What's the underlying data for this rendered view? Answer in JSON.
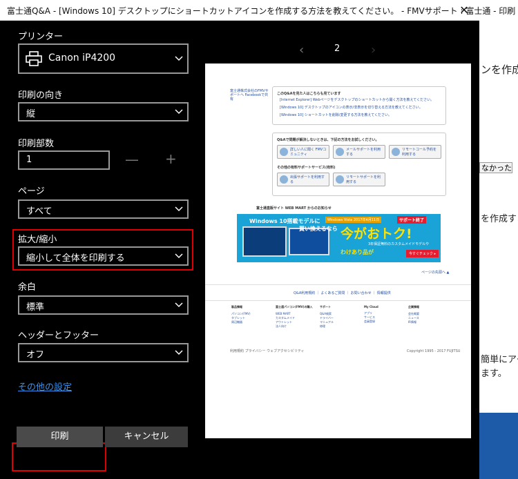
{
  "window": {
    "title": "富士通Q&A - [Windows 10] デスクトップにショートカットアイコンを作成する方法を教えてください。 - FMVサポート : 富士通 - 印刷",
    "close_glyph": "✕"
  },
  "background_page": {
    "text1": "ンを作成",
    "button": "なかった",
    "text2": "を作成す",
    "text3": "簡単にアク",
    "text4": "ます。"
  },
  "settings": {
    "printer_label": "プリンター",
    "printer_value": "Canon iP4200",
    "orientation_label": "印刷の向き",
    "orientation_value": "縦",
    "copies_label": "印刷部数",
    "copies_value": "1",
    "copies_minus": "—",
    "copies_plus": "+",
    "pages_label": "ページ",
    "pages_value": "すべて",
    "scale_label": "拡大/縮小",
    "scale_value": "縮小して全体を印刷する",
    "margins_label": "余白",
    "margins_value": "標準",
    "headers_label": "ヘッダーとフッター",
    "headers_value": "オフ",
    "more_settings": "その他の設定"
  },
  "buttons": {
    "print": "印刷",
    "cancel": "キャンセル"
  },
  "preview": {
    "prev_glyph": "‹",
    "next_glyph": "›",
    "page_number": "2",
    "links_text": "富士通株式会社のFMVサポートへ Facebookで共有",
    "box1_heading": "このQ&Aを見た人はこちらも見ています",
    "box1_items": [
      "[Internet Explorer] Webページをデスクトップのショートカットから開く方法を教えてください。",
      "[Windows 10] デスクトップのアイコンの表示/非表示を切り替える方法を教えてください。",
      "[Windows 10] ショートカットを削除/変更する方法を教えてください。"
    ],
    "box2_heading": "Q&Aで問題が解決しないときは、下記の方法をお試しください。",
    "box2_buttons": [
      "詳しい人に聞く FMVコミュニティ",
      "メールサポートを利用する",
      "リモートコール予約を利用する"
    ],
    "box2_sub": "その他の有料サポートサービス(有料)",
    "box2_buttons2": [
      "出張サポートを利用する",
      "リモートサポートを利用する"
    ],
    "banner_caption": "富士通直販サイト WEB MART からのお知らせ",
    "banner": {
      "t1": "Windows 10搭載モデルに",
      "t1b": "買い換えるなら",
      "t2": "Windows Vista 2017年4月11日",
      "t3": "サポート終了",
      "t4": "今がおトク!",
      "t5": "3年保証無料のカスタムメイドモデルや",
      "t6": "わけあり品が",
      "t7": "今すぐチェック ▸"
    },
    "pagetop": "ページの先頭へ ▲",
    "mid_links": "Q&A利用規約  ｜  よくあるご質問  ｜  お問い合わせ  ｜  情報提供",
    "footer_cols": [
      {
        "h": "製品情報",
        "i": [
          "パソコン(FMV)",
          "タブレット",
          "周辺機器"
        ]
      },
      {
        "h": "富士通パソコン(FMV)の購入",
        "i": [
          "WEB MART",
          "カスタムメイド",
          "アウトレット",
          "法人向け"
        ]
      },
      {
        "h": "サポート",
        "i": [
          "Q&A検索",
          "ドライバー",
          "マニュアル",
          "修理"
        ]
      },
      {
        "h": "My Cloud",
        "i": [
          "アプリ",
          "サービス",
          "会員登録"
        ]
      },
      {
        "h": "企業情報",
        "i": [
          "会社概要",
          "ニュース",
          "IR情報"
        ]
      }
    ],
    "footer_left": "利用規約  プライバシー  ウェブアクセシビリティ",
    "copyright": "Copyright 1995 - 2017 FUJITSU"
  },
  "colors": {
    "highlight": "#e00000",
    "link": "#3b90e6"
  }
}
